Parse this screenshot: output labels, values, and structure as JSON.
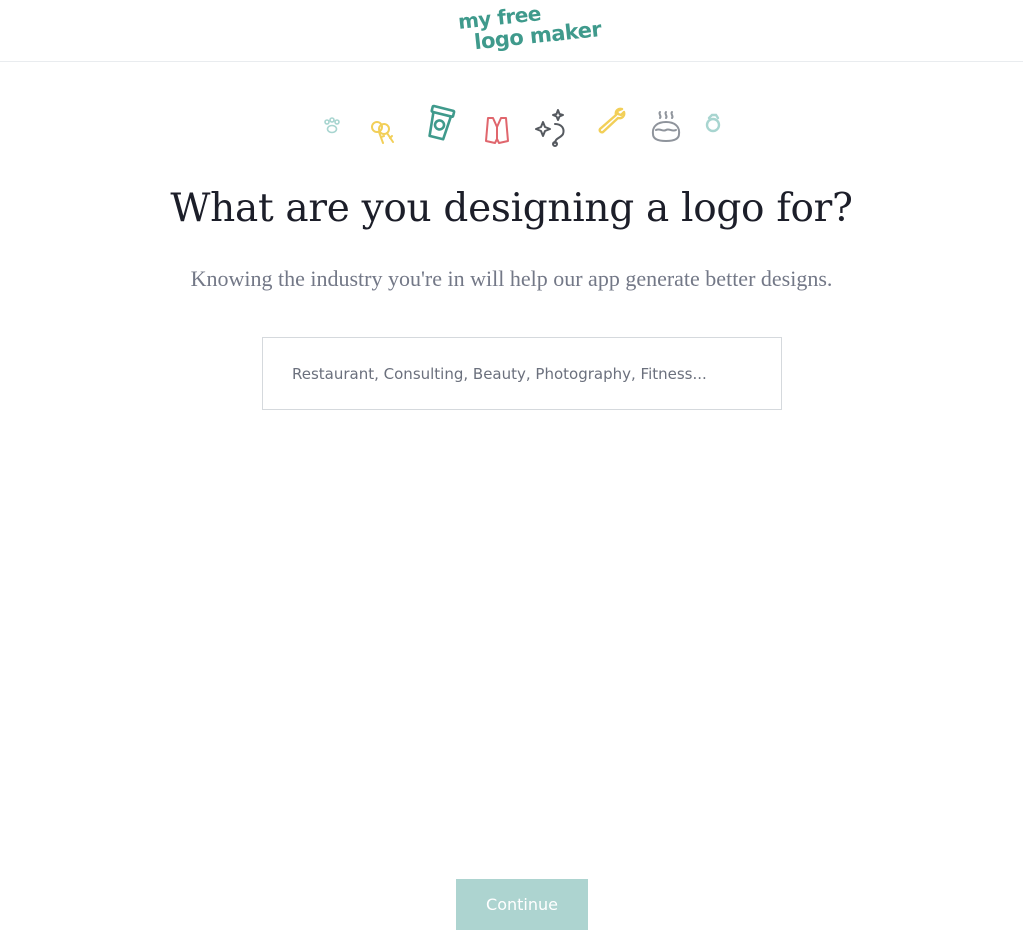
{
  "header": {
    "logo_line1": "my free",
    "logo_line2": "logo maker",
    "brand_color": "#3f9a8c"
  },
  "icons": [
    {
      "name": "paw-icon",
      "color": "#a8d5d0"
    },
    {
      "name": "keys-icon",
      "color": "#f2cf58"
    },
    {
      "name": "coffee-cup-icon",
      "color": "#3f9a8c"
    },
    {
      "name": "vest-icon",
      "color": "#e0666d"
    },
    {
      "name": "sparkle-icon",
      "color": "#55595f"
    },
    {
      "name": "wrench-icon",
      "color": "#f2cf58"
    },
    {
      "name": "pie-icon",
      "color": "#8f949c"
    },
    {
      "name": "ring-icon",
      "color": "#a8d5d0"
    }
  ],
  "main": {
    "title": "What are you designing a logo for?",
    "subtitle": "Knowing the industry you're in will help our app generate better designs.",
    "search": {
      "placeholder": "Restaurant, Consulting, Beauty, Photography, Fitness...",
      "value": ""
    }
  },
  "footer": {
    "continue_label": "Continue",
    "continue_color": "#add4d0"
  }
}
